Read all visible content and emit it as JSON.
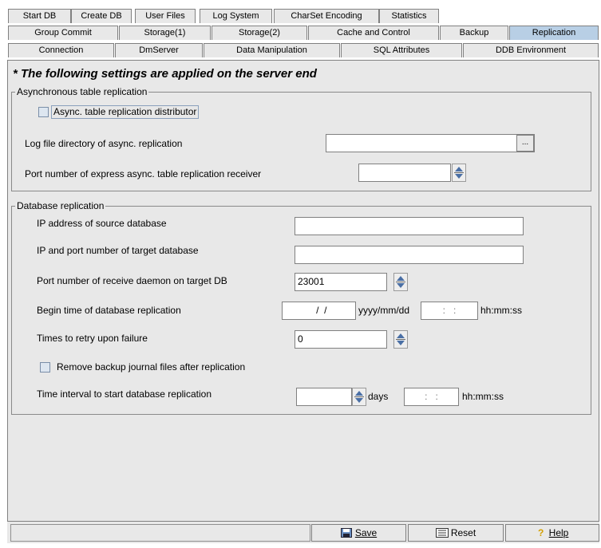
{
  "tabs": {
    "row1": [
      "Start DB",
      "Create DB",
      "User Files",
      "Log System",
      "CharSet Encoding",
      "Statistics"
    ],
    "row2": [
      "Group Commit",
      "Storage(1)",
      "Storage(2)",
      "Cache and Control",
      "Backup",
      "Replication"
    ],
    "row3": [
      "Connection",
      "DmServer",
      "Data Manipulation",
      "SQL Attributes",
      "DDB Environment"
    ],
    "active": "Replication"
  },
  "notice": "* The following settings are applied on the server end",
  "async_group": {
    "legend": "Asynchronous table replication",
    "distributor_label": "Async. table replication distributor",
    "distributor_checked": false,
    "logdir_label": "Log file directory of async. replication",
    "logdir_value": "",
    "browse_label": "...",
    "port_label": "Port number of express async. table replication receiver",
    "port_value": ""
  },
  "db_group": {
    "legend": "Database replication",
    "source_ip_label": "IP address of source database",
    "source_ip_value": "",
    "target_label": "IP and port number of target database",
    "target_value": "",
    "daemon_port_label": "Port number of receive daemon on target DB",
    "daemon_port_value": "23001",
    "begin_label": "Begin time of database replication",
    "begin_date_value": "  /  /",
    "date_format": "yyyy/mm/dd",
    "begin_time_value": ":   :",
    "time_format": "hh:mm:ss",
    "retry_label": "Times to retry upon failure",
    "retry_value": "0",
    "remove_label": "Remove backup journal files after replication",
    "remove_checked": false,
    "interval_label": "Time interval to start database replication",
    "interval_days_value": "",
    "days_label": "days",
    "interval_time_value": ":   :",
    "interval_time_format": "hh:mm:ss"
  },
  "footer": {
    "status_text": "",
    "save_label": "Save",
    "reset_label": "Reset",
    "help_label": "Help"
  }
}
